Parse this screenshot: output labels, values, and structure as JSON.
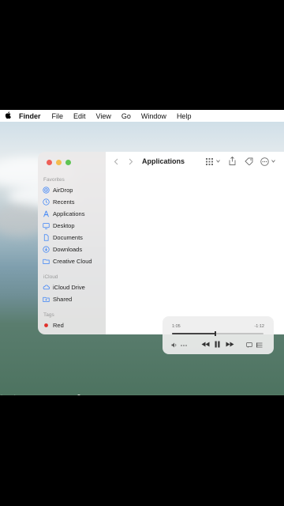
{
  "menubar": {
    "apple": "",
    "app_name": "Finder",
    "items": [
      "File",
      "Edit",
      "View",
      "Go",
      "Window",
      "Help"
    ]
  },
  "finder": {
    "title": "Applications",
    "sidebar": {
      "favorites_title": "Favorites",
      "favorites": [
        {
          "label": "AirDrop",
          "icon": "airdrop-icon"
        },
        {
          "label": "Recents",
          "icon": "clock-icon"
        },
        {
          "label": "Applications",
          "icon": "applications-icon"
        },
        {
          "label": "Desktop",
          "icon": "desktop-icon"
        },
        {
          "label": "Documents",
          "icon": "document-icon"
        },
        {
          "label": "Downloads",
          "icon": "download-icon"
        },
        {
          "label": "Creative Cloud",
          "icon": "folder-icon"
        }
      ],
      "icloud_title": "iCloud",
      "icloud": [
        {
          "label": "iCloud Drive",
          "icon": "cloud-icon"
        },
        {
          "label": "Shared",
          "icon": "shared-folder-icon"
        }
      ],
      "tags_title": "Tags",
      "tags": [
        {
          "label": "Red",
          "color": "#e0302a"
        }
      ]
    }
  },
  "player": {
    "elapsed": "1:05",
    "remaining": "-1:12",
    "progress": 0.47
  },
  "colors": {
    "traffic_red": "#ee5f57",
    "traffic_yellow": "#f4bd4f",
    "traffic_green": "#5fc454",
    "accent": "#3a82f7"
  }
}
